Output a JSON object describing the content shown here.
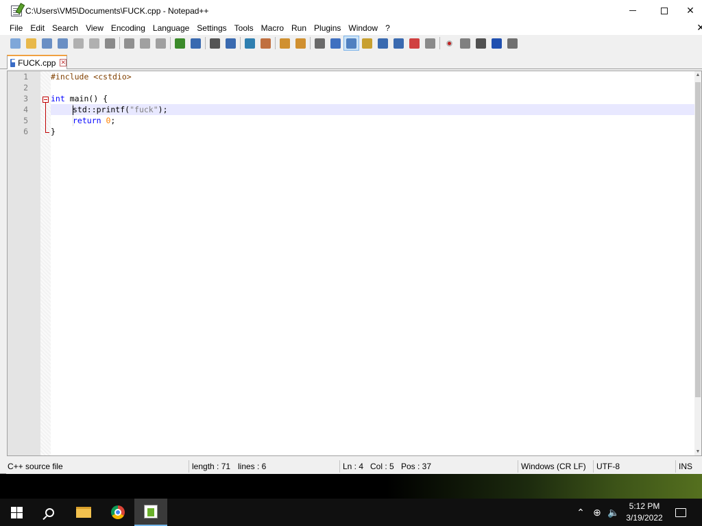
{
  "window": {
    "title": "C:\\Users\\VM5\\Documents\\FUCK.cpp - Notepad++",
    "close_glyph": "✕"
  },
  "menu": {
    "items": [
      "File",
      "Edit",
      "Search",
      "View",
      "Encoding",
      "Language",
      "Settings",
      "Tools",
      "Macro",
      "Run",
      "Plugins",
      "Window",
      "?"
    ],
    "close_doc": "✕"
  },
  "toolbar": {
    "buttons": [
      "new-file",
      "open-file",
      "save",
      "save-all",
      "close",
      "close-all",
      "print",
      "cut",
      "copy",
      "paste",
      "undo",
      "redo",
      "find",
      "replace",
      "zoom-in",
      "zoom-out",
      "sync-vertical",
      "sync-horizontal",
      "word-wrap",
      "show-all-characters",
      "indent-guide",
      "user-defined-language",
      "document-map",
      "function-list",
      "folder-as-workspace",
      "monitoring",
      "record-macro",
      "stop-recording",
      "play-macro",
      "run-macro-multiple",
      "save-macro"
    ]
  },
  "tab": {
    "label": "FUCK.cpp",
    "close": "✕"
  },
  "editor": {
    "line_numbers": [
      "1",
      "2",
      "3",
      "4",
      "5",
      "6"
    ],
    "lines": [
      {
        "pp": "#include <cstdio>"
      },
      {},
      {
        "kw": "int",
        "rest": " main() {"
      },
      {
        "fn": "std::printf(",
        "str": "\"fuck\"",
        "end": ");"
      },
      {
        "kw": "return",
        "num": "0",
        "end": ";"
      },
      {
        "close": "}"
      }
    ],
    "current_line": 4
  },
  "statusbar": {
    "language": "C++ source file",
    "length": "length : 71",
    "lines": "lines : 6",
    "ln": "Ln : 4",
    "col": "Col : 5",
    "pos": "Pos : 37",
    "eol": "Windows (CR LF)",
    "encoding": "UTF-8",
    "mode": "INS"
  },
  "taskbar": {
    "time": "5:12 PM",
    "date": "3/19/2022",
    "tray_chevron": "⌃"
  },
  "colors": {
    "keyword": "#0000ff",
    "preprocessor": "#804000",
    "string": "#808080",
    "number": "#ff8000",
    "current_line": "#e8e8ff",
    "fold_marker": "#c00000"
  }
}
